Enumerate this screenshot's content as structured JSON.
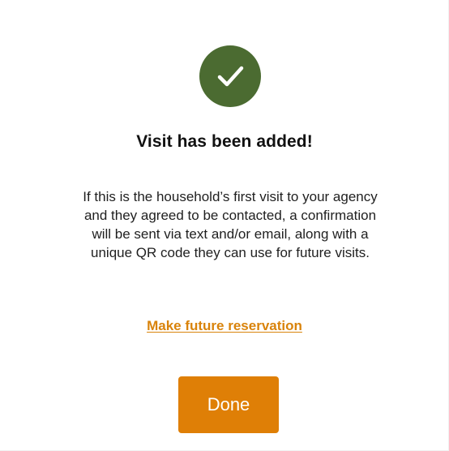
{
  "dialog": {
    "success_icon": "checkmark-icon",
    "title": "Visit has been added!",
    "message_lines": [
      "If this is the household’s first visit to your agency",
      "and they agreed to be contacted, a confirmation",
      "will be sent via text and/or email, along with a",
      "unique QR code they can use for future visits."
    ],
    "future_reservation_link": "Make future reservation",
    "done_label": "Done"
  },
  "colors": {
    "success_green": "#4b6b31",
    "accent_orange": "#df7f06",
    "link_orange": "#d9830b"
  }
}
